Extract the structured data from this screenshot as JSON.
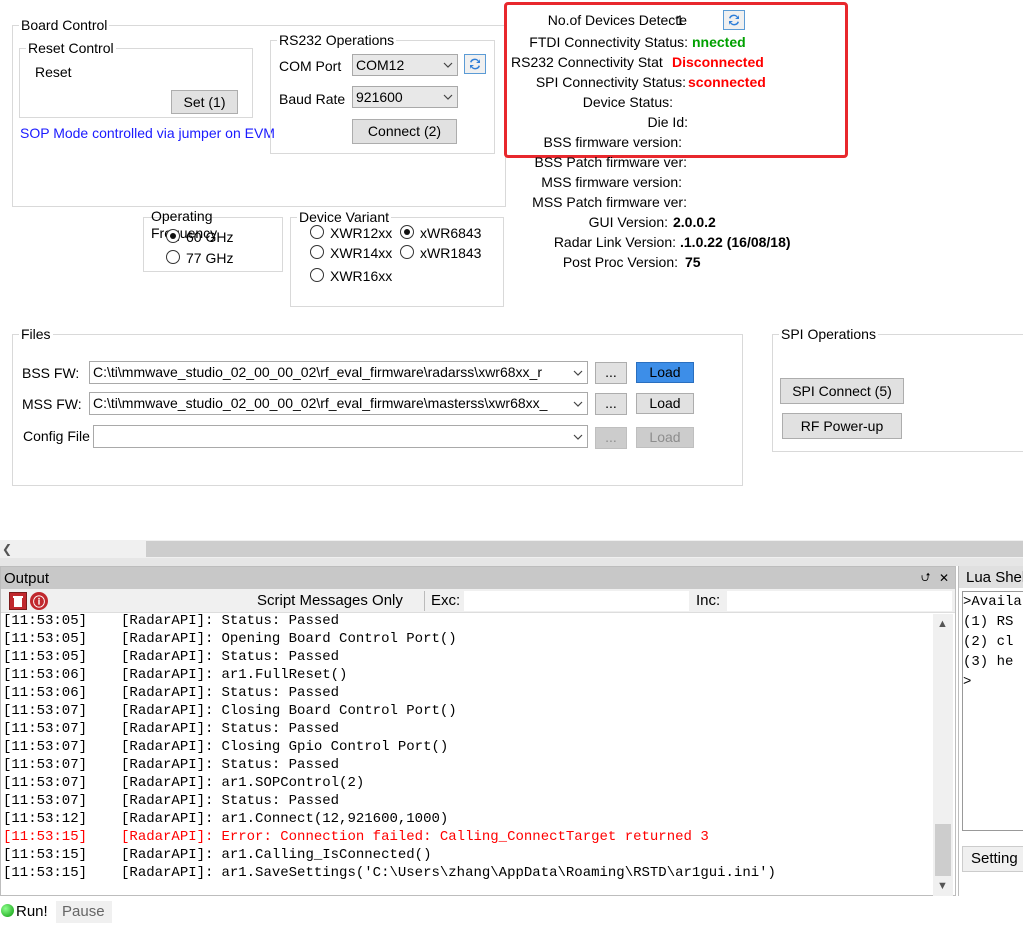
{
  "board_control": {
    "title": "Board Control",
    "reset_control": {
      "title": "Reset Control",
      "label": "Reset",
      "set_button": "Set (1)"
    },
    "sop_note": "SOP Mode controlled via jumper on EVM"
  },
  "rs232": {
    "title": "RS232 Operations",
    "com_port_label": "COM Port",
    "com_port_value": "COM12",
    "baud_rate_label": "Baud Rate",
    "baud_rate_value": "921600",
    "connect_button": "Connect (2)"
  },
  "status": {
    "devices_label": "No.of Devices Detecte",
    "devices_value": "1",
    "ftdi_label": "FTDI Connectivity Status:",
    "ftdi_value": "nnected",
    "rs232_label": "RS232 Connectivity Stat",
    "rs232_value": "Disconnected",
    "spi_label": "SPI Connectivity Status:",
    "spi_value": "sconnected",
    "device_status_label": "Device Status:",
    "die_id_label": "Die Id:",
    "bss_fw_label": "BSS firmware version:",
    "bss_patch_label": "BSS Patch firmware ver:",
    "mss_fw_label": "MSS firmware version:",
    "mss_patch_label": "MSS Patch firmware ver:",
    "gui_version_label": "GUI Version:",
    "gui_version_value": "2.0.0.2",
    "radar_link_label": "Radar Link Version:",
    "radar_link_value": ".1.0.22 (16/08/18)",
    "post_proc_label": "Post Proc Version:",
    "post_proc_value": "75",
    "highlight_color": "#e8282d"
  },
  "operating_freq": {
    "title": "Operating Frequency",
    "opt_60": "60 GHz",
    "opt_77": "77 GHz"
  },
  "device_variant": {
    "title": "Device Variant",
    "opt_12xx": "XWR12xx",
    "opt_6843": "xWR6843",
    "opt_14xx": "XWR14xx",
    "opt_1843": "xWR1843",
    "opt_16xx": "XWR16xx"
  },
  "files": {
    "title": "Files",
    "bss_label": "BSS FW:",
    "bss_path": "C:\\ti\\mmwave_studio_02_00_00_02\\rf_eval_firmware\\radarss\\xwr68xx_r",
    "mss_label": "MSS FW:",
    "mss_path": "C:\\ti\\mmwave_studio_02_00_00_02\\rf_eval_firmware\\masterss\\xwr68xx_",
    "config_label": "Config File",
    "config_path": "",
    "browse": "...",
    "load": "Load"
  },
  "spi": {
    "title": "SPI Operations",
    "connect_button": "SPI Connect (5)",
    "rf_powerup_button": "RF Power-up"
  },
  "output": {
    "title": "Output",
    "pin": "⮍",
    "close": "✕",
    "script_only": "Script Messages Only",
    "exc_label": "Exc:",
    "inc_label": "Inc:",
    "log": [
      {
        "t": "[11:53:05]",
        "src": "[RadarAPI]:",
        "msg": "Status: Passed",
        "err": false
      },
      {
        "t": "[11:53:05]",
        "src": "[RadarAPI]:",
        "msg": "Opening Board Control Port()",
        "err": false
      },
      {
        "t": "[11:53:05]",
        "src": "[RadarAPI]:",
        "msg": "Status: Passed",
        "err": false
      },
      {
        "t": "[11:53:06]",
        "src": "[RadarAPI]:",
        "msg": "ar1.FullReset()",
        "err": false
      },
      {
        "t": "[11:53:06]",
        "src": "[RadarAPI]:",
        "msg": "Status: Passed",
        "err": false
      },
      {
        "t": "[11:53:07]",
        "src": "[RadarAPI]:",
        "msg": "Closing Board Control Port()",
        "err": false
      },
      {
        "t": "[11:53:07]",
        "src": "[RadarAPI]:",
        "msg": "Status: Passed",
        "err": false
      },
      {
        "t": "[11:53:07]",
        "src": "[RadarAPI]:",
        "msg": "Closing Gpio Control Port()",
        "err": false
      },
      {
        "t": "[11:53:07]",
        "src": "[RadarAPI]:",
        "msg": "Status: Passed",
        "err": false
      },
      {
        "t": "[11:53:07]",
        "src": "[RadarAPI]:",
        "msg": "ar1.SOPControl(2)",
        "err": false
      },
      {
        "t": "[11:53:07]",
        "src": "[RadarAPI]:",
        "msg": "Status: Passed",
        "err": false
      },
      {
        "t": "[11:53:12]",
        "src": "[RadarAPI]:",
        "msg": "ar1.Connect(12,921600,1000)",
        "err": false
      },
      {
        "t": "[11:53:15]",
        "src": "[RadarAPI]:",
        "msg": "Error: Connection failed: Calling_ConnectTarget returned 3",
        "err": true
      },
      {
        "t": "[11:53:15]",
        "src": "[RadarAPI]:",
        "msg": "ar1.Calling_IsConnected()",
        "err": false
      },
      {
        "t": "[11:53:15]",
        "src": "[RadarAPI]:",
        "msg": "ar1.SaveSettings('C:\\Users\\zhang\\AppData\\Roaming\\RSTD\\ar1gui.ini')",
        "err": false
      }
    ]
  },
  "lua": {
    "title": "Lua Shel",
    "lines": [
      ">Availa",
      "(1) RS",
      "(2) cl",
      "(3) he",
      ">"
    ],
    "settings_tab": "Setting"
  },
  "run_bar": {
    "run": "Run!",
    "pause": "Pause"
  }
}
